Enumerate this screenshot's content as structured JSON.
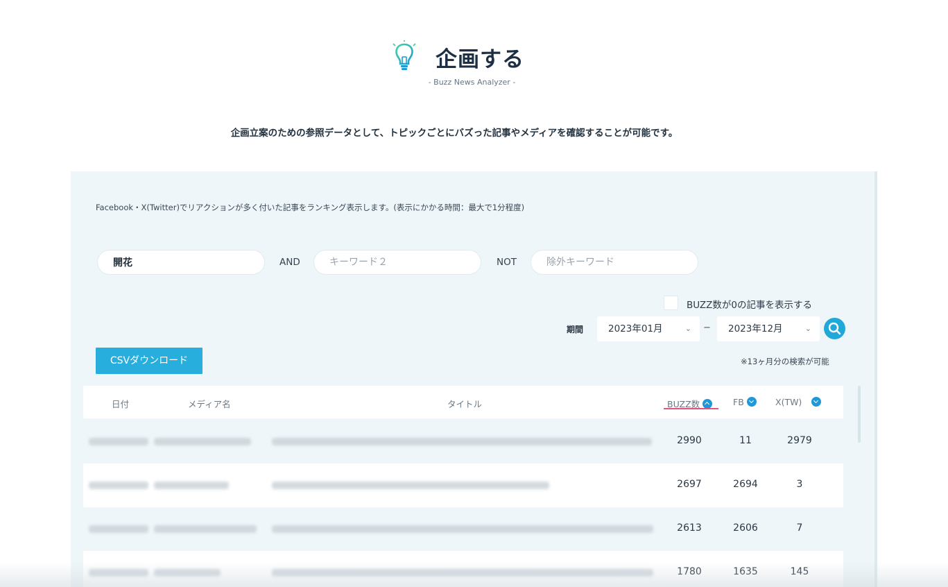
{
  "header": {
    "title": "企画する",
    "subtitle": "- Buzz News Analyzer -",
    "icon": "lightbulb-icon",
    "accent": "#27aedd"
  },
  "lead": "企画立案のための参照データとして、トピックごとにバズった記事やメディアを確認することが可能です。",
  "search": {
    "description": "Facebook・X(Twitter)でリアクションが多く付いた記事をランキング表示します。(表示にかかる時間：最大で1分程度)",
    "keyword1_value": "開花",
    "keyword2_placeholder": "キーワード２",
    "exclude_placeholder": "除外キーワード",
    "and_label": "AND",
    "not_label": "NOT",
    "show_zero_label": "BUZZ数が0の記事を表示する",
    "period_label": "期間",
    "period_from": "2023年01月",
    "period_to": "2023年12月",
    "period_separator": "−",
    "note": "※13ヶ月分の検索が可能"
  },
  "csv_button": "CSVダウンロード",
  "table": {
    "headers": {
      "date": "日付",
      "media": "メディア名",
      "title": "タイトル",
      "buzz": "BUZZ数",
      "fb": "FB",
      "tw": "X(TW)"
    },
    "rows": [
      {
        "buzz": "2990",
        "fb": "11",
        "tw": "2979"
      },
      {
        "buzz": "2697",
        "fb": "2694",
        "tw": "3"
      },
      {
        "buzz": "2613",
        "fb": "2606",
        "tw": "7"
      },
      {
        "buzz": "1780",
        "fb": "1635",
        "tw": "145"
      }
    ]
  }
}
